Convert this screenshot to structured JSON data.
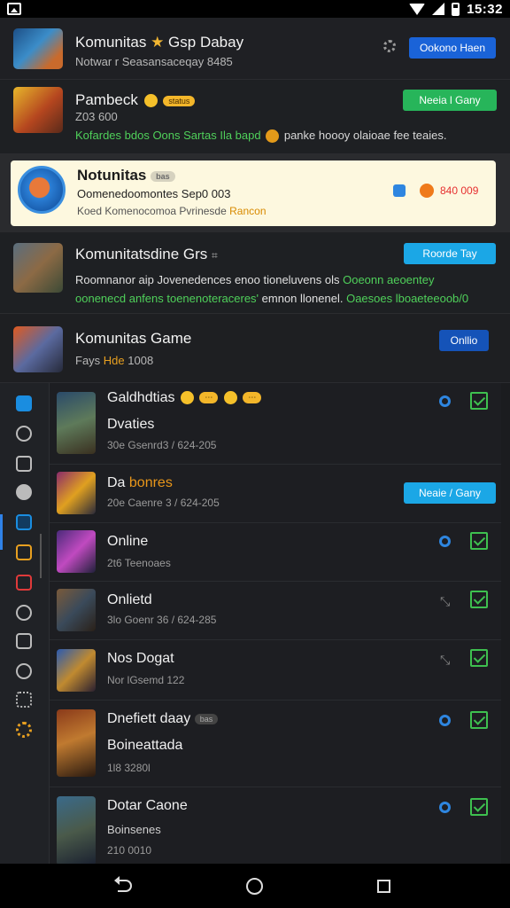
{
  "status_bar": {
    "time": "15:32"
  },
  "notifications": [
    {
      "title": "Komunitas",
      "title_extra": "Gsp Dabay",
      "subtitle": "Notwar r Seasansaceqay 8485",
      "button": "Ookono Haen",
      "colors": {
        "button": "#1a63d8"
      }
    },
    {
      "title": "Pambeck",
      "badge": "status",
      "meta": "Z03 600",
      "line": "Kofardes bdos Oons Sartas",
      "line2": "Ila bapd",
      "line3": "panke hoooy olaioae fee teaies.",
      "button": "Neeia l Gany",
      "colors": {
        "button": "#27b55a",
        "line": "#4fd05a"
      }
    },
    {
      "title": "Notunitas",
      "badge": "bas",
      "line": "Oomenedoomontes Sep0 003",
      "meta": "Koed Komenocomoa Pvrinesde",
      "meta_accent": "Rancon",
      "counter": "840 009",
      "colors": {
        "card": "#fdf8df",
        "accent": "#e63030"
      }
    },
    {
      "title": "Komunitatsdine Grs",
      "line_a": "Roomnanor aip Jovenedences enoo tioneluvens ols",
      "line_a_accent": "Ooeonn aeoentey",
      "line_b": "oonenecd anfens toenenoteraceres'",
      "line_b_mid": "emnon llonenel.",
      "line_b_accent": "Oaesoes lboaeteeoob/0",
      "button": "Roorde Tay",
      "colors": {
        "button": "#1ba7e6",
        "accent": "#4fd05a"
      }
    },
    {
      "title": "Komunitas Game",
      "subtitle": "Fays",
      "subtitle_accent": "Hde",
      "subtitle_tail": "1008",
      "button": "Onllio",
      "colors": {
        "button": "#1553b8"
      }
    }
  ],
  "list": [
    {
      "title": "Galdhdtias",
      "title2": "Dvaties",
      "sub": "30e Gsenrd3 / 624-205",
      "status": "online",
      "checked": true
    },
    {
      "title": "Da",
      "title_accent": "bonres",
      "sub": "20e Caenre 3 / 624-205",
      "button": "Neaie / Gany",
      "checked": false
    },
    {
      "title": "Online",
      "sub": "2t6 Teenoaes",
      "status": "online",
      "checked": true
    },
    {
      "title": "Onlietd",
      "sub": "3lo Goenr 36 / 624-285",
      "status": "idle",
      "checked": true
    },
    {
      "title": "Nos Dogat",
      "sub": "Nor lGsemd 122",
      "status": "idle",
      "checked": true
    },
    {
      "title": "Dnefiett daay",
      "badge": "bas",
      "title2": "Boineattada",
      "sub": "1l8 3280l",
      "status": "online",
      "checked": true
    },
    {
      "title": "Dotar Caone",
      "title2": "Boinsenes",
      "sub": "210 0010",
      "status": "online",
      "checked": true
    }
  ],
  "sidebar_icons": [
    "home-icon",
    "clock-icon",
    "image-icon",
    "download-icon",
    "calendar-icon",
    "frame-icon",
    "alert-icon",
    "face-icon",
    "camera-icon",
    "timer-icon",
    "tools-icon",
    "settings-icon"
  ]
}
